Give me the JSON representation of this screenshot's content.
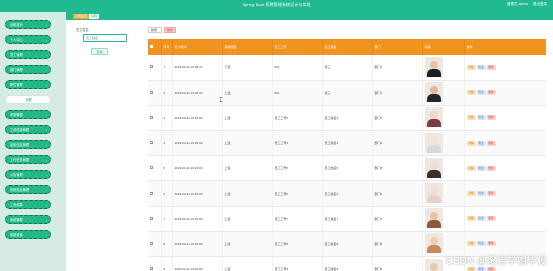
{
  "header": {
    "title": "Spring Boot 招聘管理系统设计与实现",
    "user_label": "管理员 admin",
    "logout_label": "退出登录"
  },
  "sidebar": {
    "items": [
      {
        "label": "系统首页",
        "active": false
      },
      {
        "label": "个人中心",
        "active": false
      },
      {
        "label": "员工管理",
        "active": false
      },
      {
        "label": "部门管理",
        "active": false
      },
      {
        "label": "职位管理",
        "active": false
      },
      {
        "label": "请假",
        "active": true
      },
      {
        "label": "考勤管理",
        "active": false
      },
      {
        "label": "工资信息管理",
        "active": false
      },
      {
        "label": "加班信息管理",
        "active": false
      },
      {
        "label": "工作任务管理",
        "active": false
      },
      {
        "label": "公告管理",
        "active": false
      },
      {
        "label": "系统信息管理",
        "active": false
      },
      {
        "label": "工资结算",
        "active": false
      },
      {
        "label": "系统管理",
        "active": false
      },
      {
        "label": "系统设置",
        "active": false
      }
    ]
  },
  "breadcrumb": {
    "home": "系统首页",
    "current": "请假"
  },
  "search": {
    "label": "员工姓名",
    "placeholder": "员工姓名",
    "button": "查询"
  },
  "actions": {
    "add": "新增",
    "delete": "删除"
  },
  "table": {
    "headers": [
      "",
      "序号",
      "打卡时间",
      "请假类型",
      "员工工号",
      "员工姓名",
      "部门",
      "头像",
      "操作"
    ],
    "ops": {
      "detail": "详情",
      "edit": "修改",
      "remove": "删除"
    },
    "rows": [
      {
        "index": "1",
        "time": "2023-03-21 16:09:47",
        "type": "下班",
        "emp_no": "001",
        "name": "张三",
        "dept": "部门1",
        "skin": "#e8c3a6",
        "shirt": "#1e1e1e"
      },
      {
        "index": "2",
        "time": "2023-03-21 16:09:33",
        "type": "上班",
        "emp_no": "001",
        "name": "张三",
        "dept": "部门1",
        "skin": "#e0b89b",
        "shirt": "#252525"
      },
      {
        "index": "3",
        "time": "2023-03-21 16:20:99",
        "type": "上班",
        "emp_no": "员工工号3",
        "name": "员工姓名3",
        "dept": "部门3",
        "skin": "#f1d6c6",
        "shirt": "#7a3b4a"
      },
      {
        "index": "4",
        "time": "2023-03-21 16:20:99",
        "type": "上班",
        "emp_no": "员工工号4",
        "name": "员工姓名4",
        "dept": "部门4",
        "skin": "#f4e3d8",
        "shirt": "#d8d8dc"
      },
      {
        "index": "5",
        "time": "2023-03-21 16:20:99",
        "type": "上班",
        "emp_no": "员工工号5",
        "name": "员工姓名5",
        "dept": "部门5",
        "skin": "#f3dcd0",
        "shirt": "#3b2f2f"
      },
      {
        "index": "6",
        "time": "2023-03-21 16:20:99",
        "type": "上班",
        "emp_no": "员工工号6",
        "name": "员工姓名6",
        "dept": "部门6",
        "skin": "#f2ddd3",
        "shirt": "#e6d2c8"
      },
      {
        "index": "7",
        "time": "2023-03-21 16:20:99",
        "type": "上班",
        "emp_no": "员工工号7",
        "name": "员工姓名7",
        "dept": "部门7",
        "skin": "#e7c2a6",
        "shirt": "#8a5a3a"
      },
      {
        "index": "8",
        "time": "2023-03-21 16:20:99",
        "type": "上班",
        "emp_no": "员工工号8",
        "name": "员工姓名8",
        "dept": "部门8",
        "skin": "#f0cdb4",
        "shirt": "#c98a5a"
      },
      {
        "index": "9",
        "time": "2023-03-21 16:20:99",
        "type": "上班",
        "emp_no": "员工工号9",
        "name": "员工姓名9",
        "dept": "部门9",
        "skin": "#e9c8b0",
        "shirt": "#4a3a35"
      }
    ]
  },
  "watermark": "CSDN @滚吉学姐毕设",
  "colors": {
    "primary": "#20b990",
    "header_orange": "#f0931f"
  }
}
